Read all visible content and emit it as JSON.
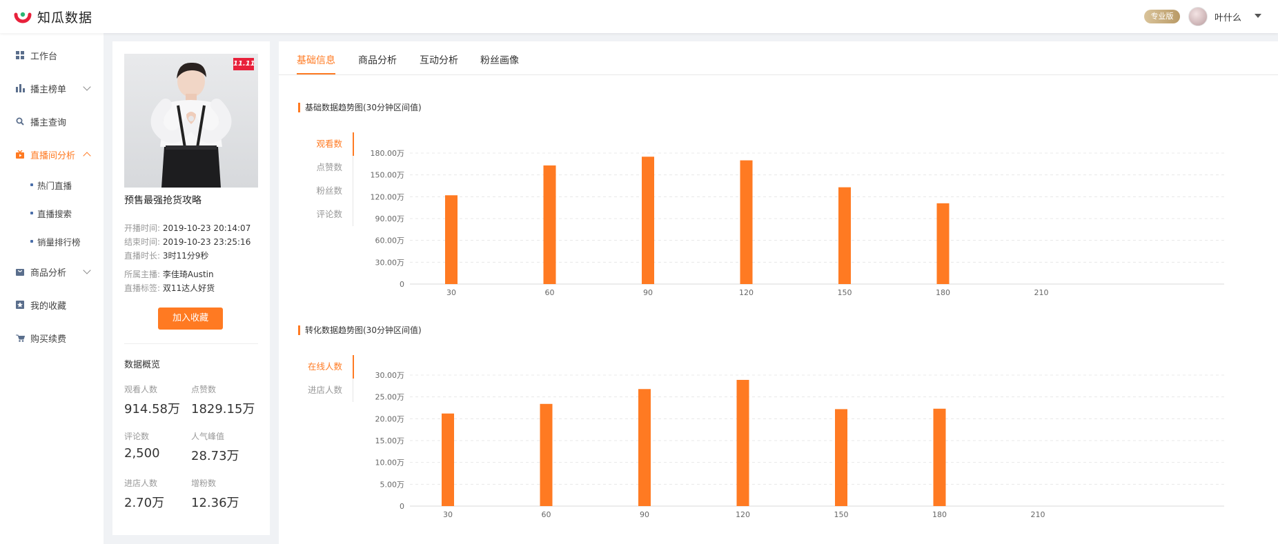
{
  "header": {
    "brand": "知瓜数据",
    "badge": "专业版",
    "username": "叶什么𠀀"
  },
  "sidebar": {
    "items": [
      {
        "label": "工作台",
        "icon": "grid-icon"
      },
      {
        "label": "播主榜单",
        "icon": "bar-chart-icon"
      },
      {
        "label": "播主查询",
        "icon": "search-icon"
      },
      {
        "label": "直播间分析",
        "icon": "live-tv-icon"
      },
      {
        "label": "商品分析",
        "icon": "bag-icon"
      },
      {
        "label": "我的收藏",
        "icon": "bookmark-icon"
      },
      {
        "label": "购买续费",
        "icon": "cart-icon"
      }
    ],
    "sub_items": [
      "热门直播",
      "直播搜索",
      "销量排行榜"
    ]
  },
  "info": {
    "cover_tag": "11.11",
    "title": "预售最强抢货攻略",
    "meta": [
      {
        "k": "开播时间:",
        "v": "2019-10-23 20:14:07"
      },
      {
        "k": "结束时间:",
        "v": "2019-10-23 23:25:16"
      },
      {
        "k": "直播时长:",
        "v": "3时11分9秒"
      },
      {
        "k": "所属主播:",
        "v": "李佳琦Austin"
      },
      {
        "k": "直播标签:",
        "v": "双11达人好货"
      }
    ],
    "collect_button": "加入收藏",
    "overview_title": "数据概览",
    "stats": [
      {
        "label": "观看人数",
        "value": "914.58万"
      },
      {
        "label": "点赞数",
        "value": "1829.15万"
      },
      {
        "label": "评论数",
        "value": "2,500"
      },
      {
        "label": "人气峰值",
        "value": "28.73万"
      },
      {
        "label": "进店人数",
        "value": "2.70万"
      },
      {
        "label": "增粉数",
        "value": "12.36万"
      }
    ]
  },
  "tabs": [
    "基础信息",
    "商品分析",
    "互动分析",
    "粉丝画像"
  ],
  "colors": {
    "accent": "#ff7a22"
  },
  "chart_data": [
    {
      "type": "bar",
      "title": "基础数据趋势图(30分钟区间值)",
      "metrics": [
        "观看数",
        "点赞数",
        "粉丝数",
        "评论数"
      ],
      "active_metric": "观看数",
      "categories": [
        "30",
        "60",
        "90",
        "120",
        "150",
        "180",
        "210"
      ],
      "values": [
        1220000,
        1630000,
        1750000,
        1700000,
        1330000,
        1110000,
        null
      ],
      "y_ticks": [
        "0",
        "30.00万",
        "60.00万",
        "90.00万",
        "120.00万",
        "150.00万",
        "180.00万"
      ],
      "ylim": [
        0,
        1800000
      ],
      "grid": true,
      "bar_color": "#ff7a22"
    },
    {
      "type": "bar",
      "title": "转化数据趋势图(30分钟区间值)",
      "metrics": [
        "在线人数",
        "进店人数"
      ],
      "active_metric": "在线人数",
      "categories": [
        "30",
        "60",
        "90",
        "120",
        "150",
        "180",
        "210"
      ],
      "values": [
        212000,
        234000,
        268000,
        289000,
        222000,
        223000,
        null
      ],
      "y_ticks": [
        "0",
        "5.00万",
        "10.00万",
        "15.00万",
        "20.00万",
        "25.00万",
        "30.00万"
      ],
      "ylim": [
        0,
        300000
      ],
      "grid": true,
      "bar_color": "#ff7a22"
    }
  ]
}
